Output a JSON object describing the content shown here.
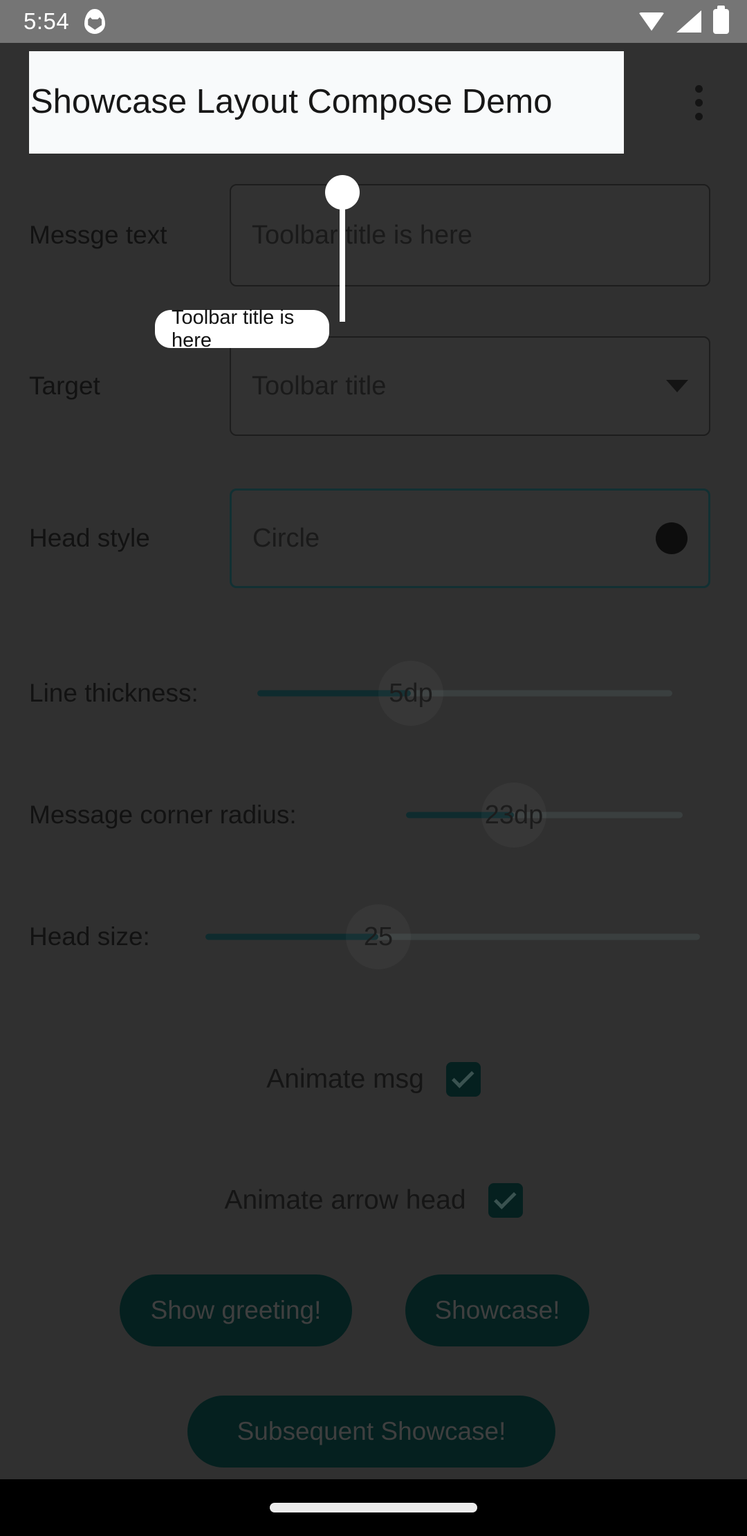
{
  "status_bar": {
    "time": "5:54",
    "icons": [
      "egg-icon",
      "wifi-icon",
      "cell-signal-icon",
      "battery-icon"
    ]
  },
  "app_bar": {
    "title": "Showcase Layout Compose Demo",
    "overflow_menu_icon": "overflow-menu-icon"
  },
  "form": {
    "message_text": {
      "label": "Messge text",
      "value": "Toolbar title is here"
    },
    "target": {
      "label": "Target",
      "value": "Toolbar title",
      "dropdown_icon": "chevron-down-icon"
    },
    "head_style": {
      "label": "Head style",
      "value": "Circle",
      "swatch_icon": "filled-circle-icon"
    },
    "line_thickness": {
      "label": "Line thickness:",
      "value": "5dp",
      "fill_percent": 37
    },
    "message_corner_radius": {
      "label": "Message corner radius:",
      "value": "23dp",
      "fill_percent": 39
    },
    "head_size": {
      "label": "Head size:",
      "value": "25",
      "fill_percent": 35
    },
    "animate_msg": {
      "label": "Animate msg",
      "checked": true
    },
    "animate_arrow_head": {
      "label": "Animate arrow head",
      "checked": true
    }
  },
  "buttons": {
    "show_greeting": "Show greeting!",
    "showcase": "Showcase!",
    "subsequent_showcase": "Subsequent Showcase!"
  },
  "showcase_overlay": {
    "message": "Toolbar title is here",
    "head_shape": "circle",
    "head_color": "#ffffff",
    "line_color": "#ffffff",
    "message_bg": "#ffffff",
    "message_text_color": "#121212"
  },
  "colors": {
    "background": "#303030",
    "status_bar": "#757575",
    "accent": "#05201f",
    "accent_border": "#123033",
    "slider_active": "#0f2b2e",
    "slider_track": "#3a3f3f",
    "highlight_bg": "#f8fafb",
    "nav_bar": "#000000"
  }
}
